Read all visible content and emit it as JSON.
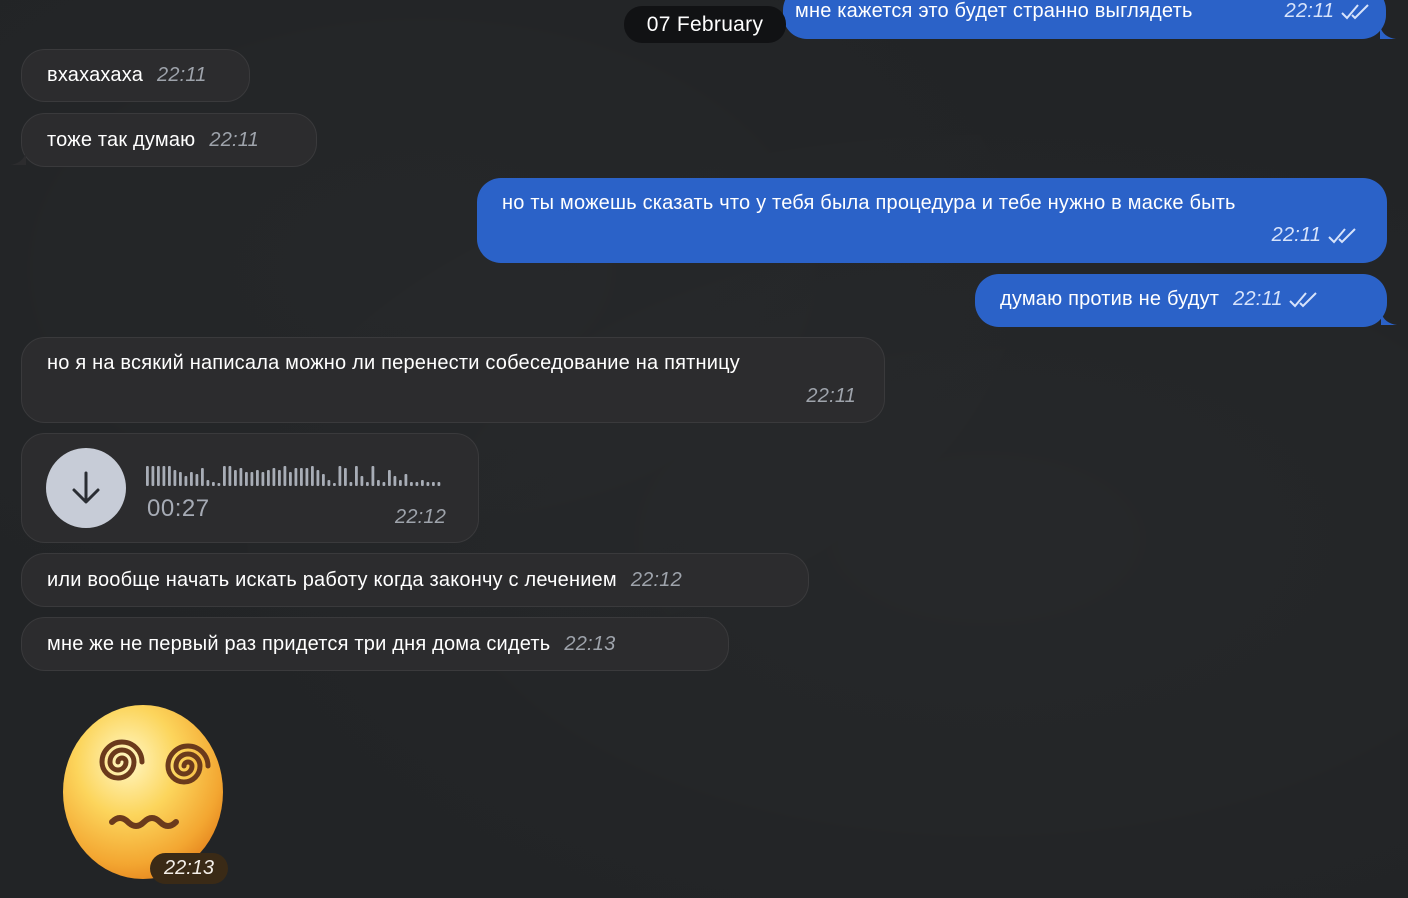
{
  "chat": {
    "date_separator": "07 February",
    "messages": [
      {
        "id": "m1",
        "direction": "outgoing",
        "text": "мне кажется это будет странно выглядеть",
        "time": "22:11",
        "status": "read"
      },
      {
        "id": "m2",
        "direction": "incoming",
        "text": "вхахахаха",
        "time": "22:11"
      },
      {
        "id": "m3",
        "direction": "incoming",
        "text": "тоже так думаю",
        "time": "22:11"
      },
      {
        "id": "m4",
        "direction": "outgoing",
        "text": "но ты можешь сказать что у тебя была процедура и тебе нужно в маске быть",
        "time": "22:11",
        "status": "read"
      },
      {
        "id": "m5",
        "direction": "outgoing",
        "text": "думаю против не будут",
        "time": "22:11",
        "status": "read"
      },
      {
        "id": "m6",
        "direction": "incoming",
        "text": "но я на всякий написала можно ли перенести собеседование на пятницу",
        "time": "22:11"
      },
      {
        "id": "m7",
        "direction": "incoming",
        "type": "voice",
        "duration": "00:27",
        "time": "22:12",
        "icon": "download-arrow-icon"
      },
      {
        "id": "m8",
        "direction": "incoming",
        "text": "или вообще начать искать работу когда закончу с лечением",
        "time": "22:12"
      },
      {
        "id": "m9",
        "direction": "incoming",
        "text": "мне же не первый раз придется три дня дома сидеть",
        "time": "22:13"
      },
      {
        "id": "m10",
        "direction": "incoming",
        "type": "sticker",
        "sticker": "dizzy-face-emoji",
        "time": "22:13"
      }
    ]
  },
  "colors": {
    "background": "#222426",
    "incoming_bubble": "#2c2c2e",
    "outgoing_bubble": "#2b62c8",
    "date_pill": "#111214"
  }
}
